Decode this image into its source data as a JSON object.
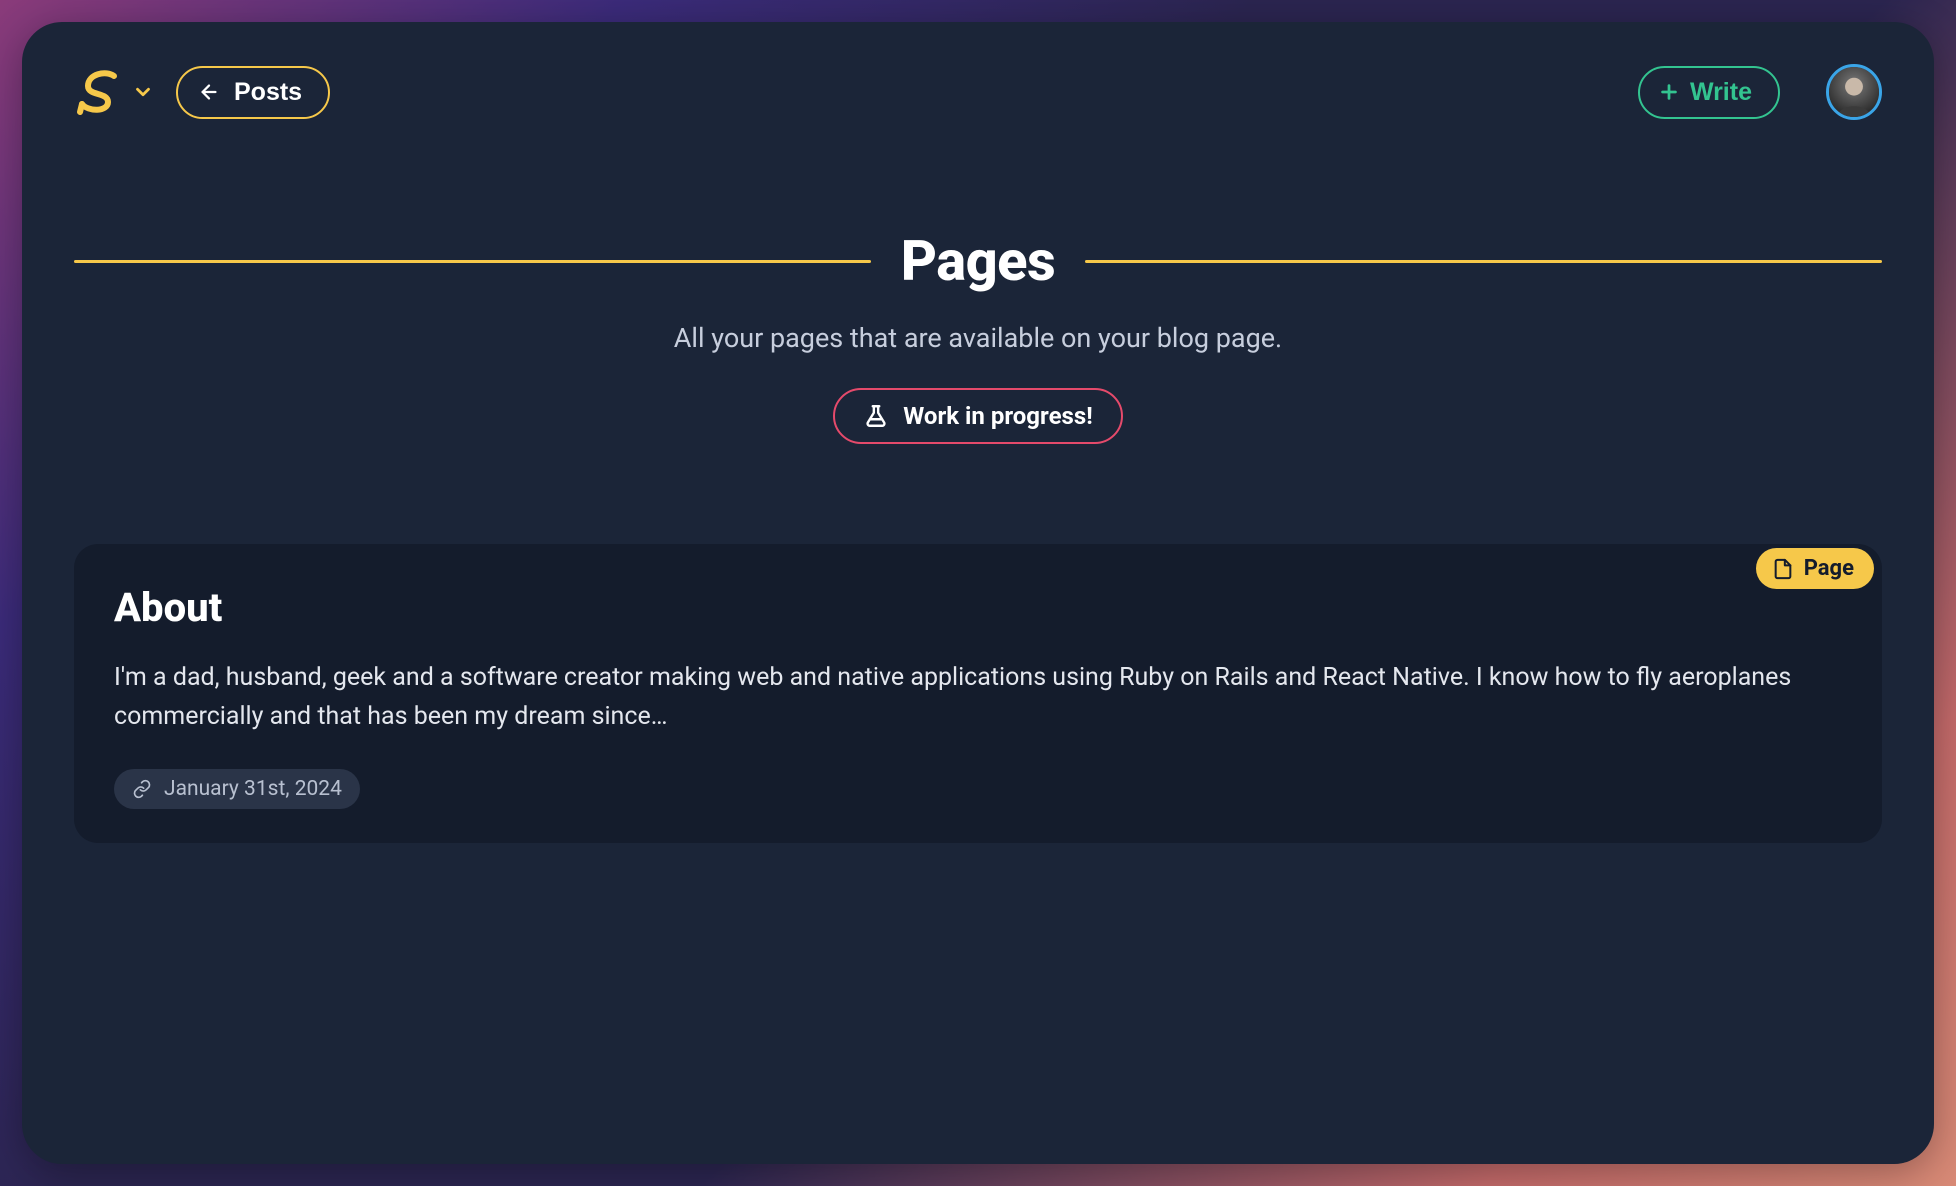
{
  "header": {
    "posts_label": "Posts",
    "write_label": "Write"
  },
  "title": {
    "heading": "Pages",
    "subtitle": "All your pages that are available on your blog page.",
    "wip_label": "Work in progress!"
  },
  "cards": [
    {
      "badge": "Page",
      "title": "About",
      "description": "I'm a dad, husband, geek and a software creator making web and native applications using Ruby on Rails and React Native. I know how to fly aeroplanes commercially and that has been my dream since…",
      "date": "January 31st, 2024"
    }
  ],
  "colors": {
    "accent_yellow": "#f6c84a",
    "accent_green": "#33c490",
    "accent_red": "#e54a6b",
    "bg_card": "#1b2538",
    "bg_inner": "#141c2c"
  }
}
